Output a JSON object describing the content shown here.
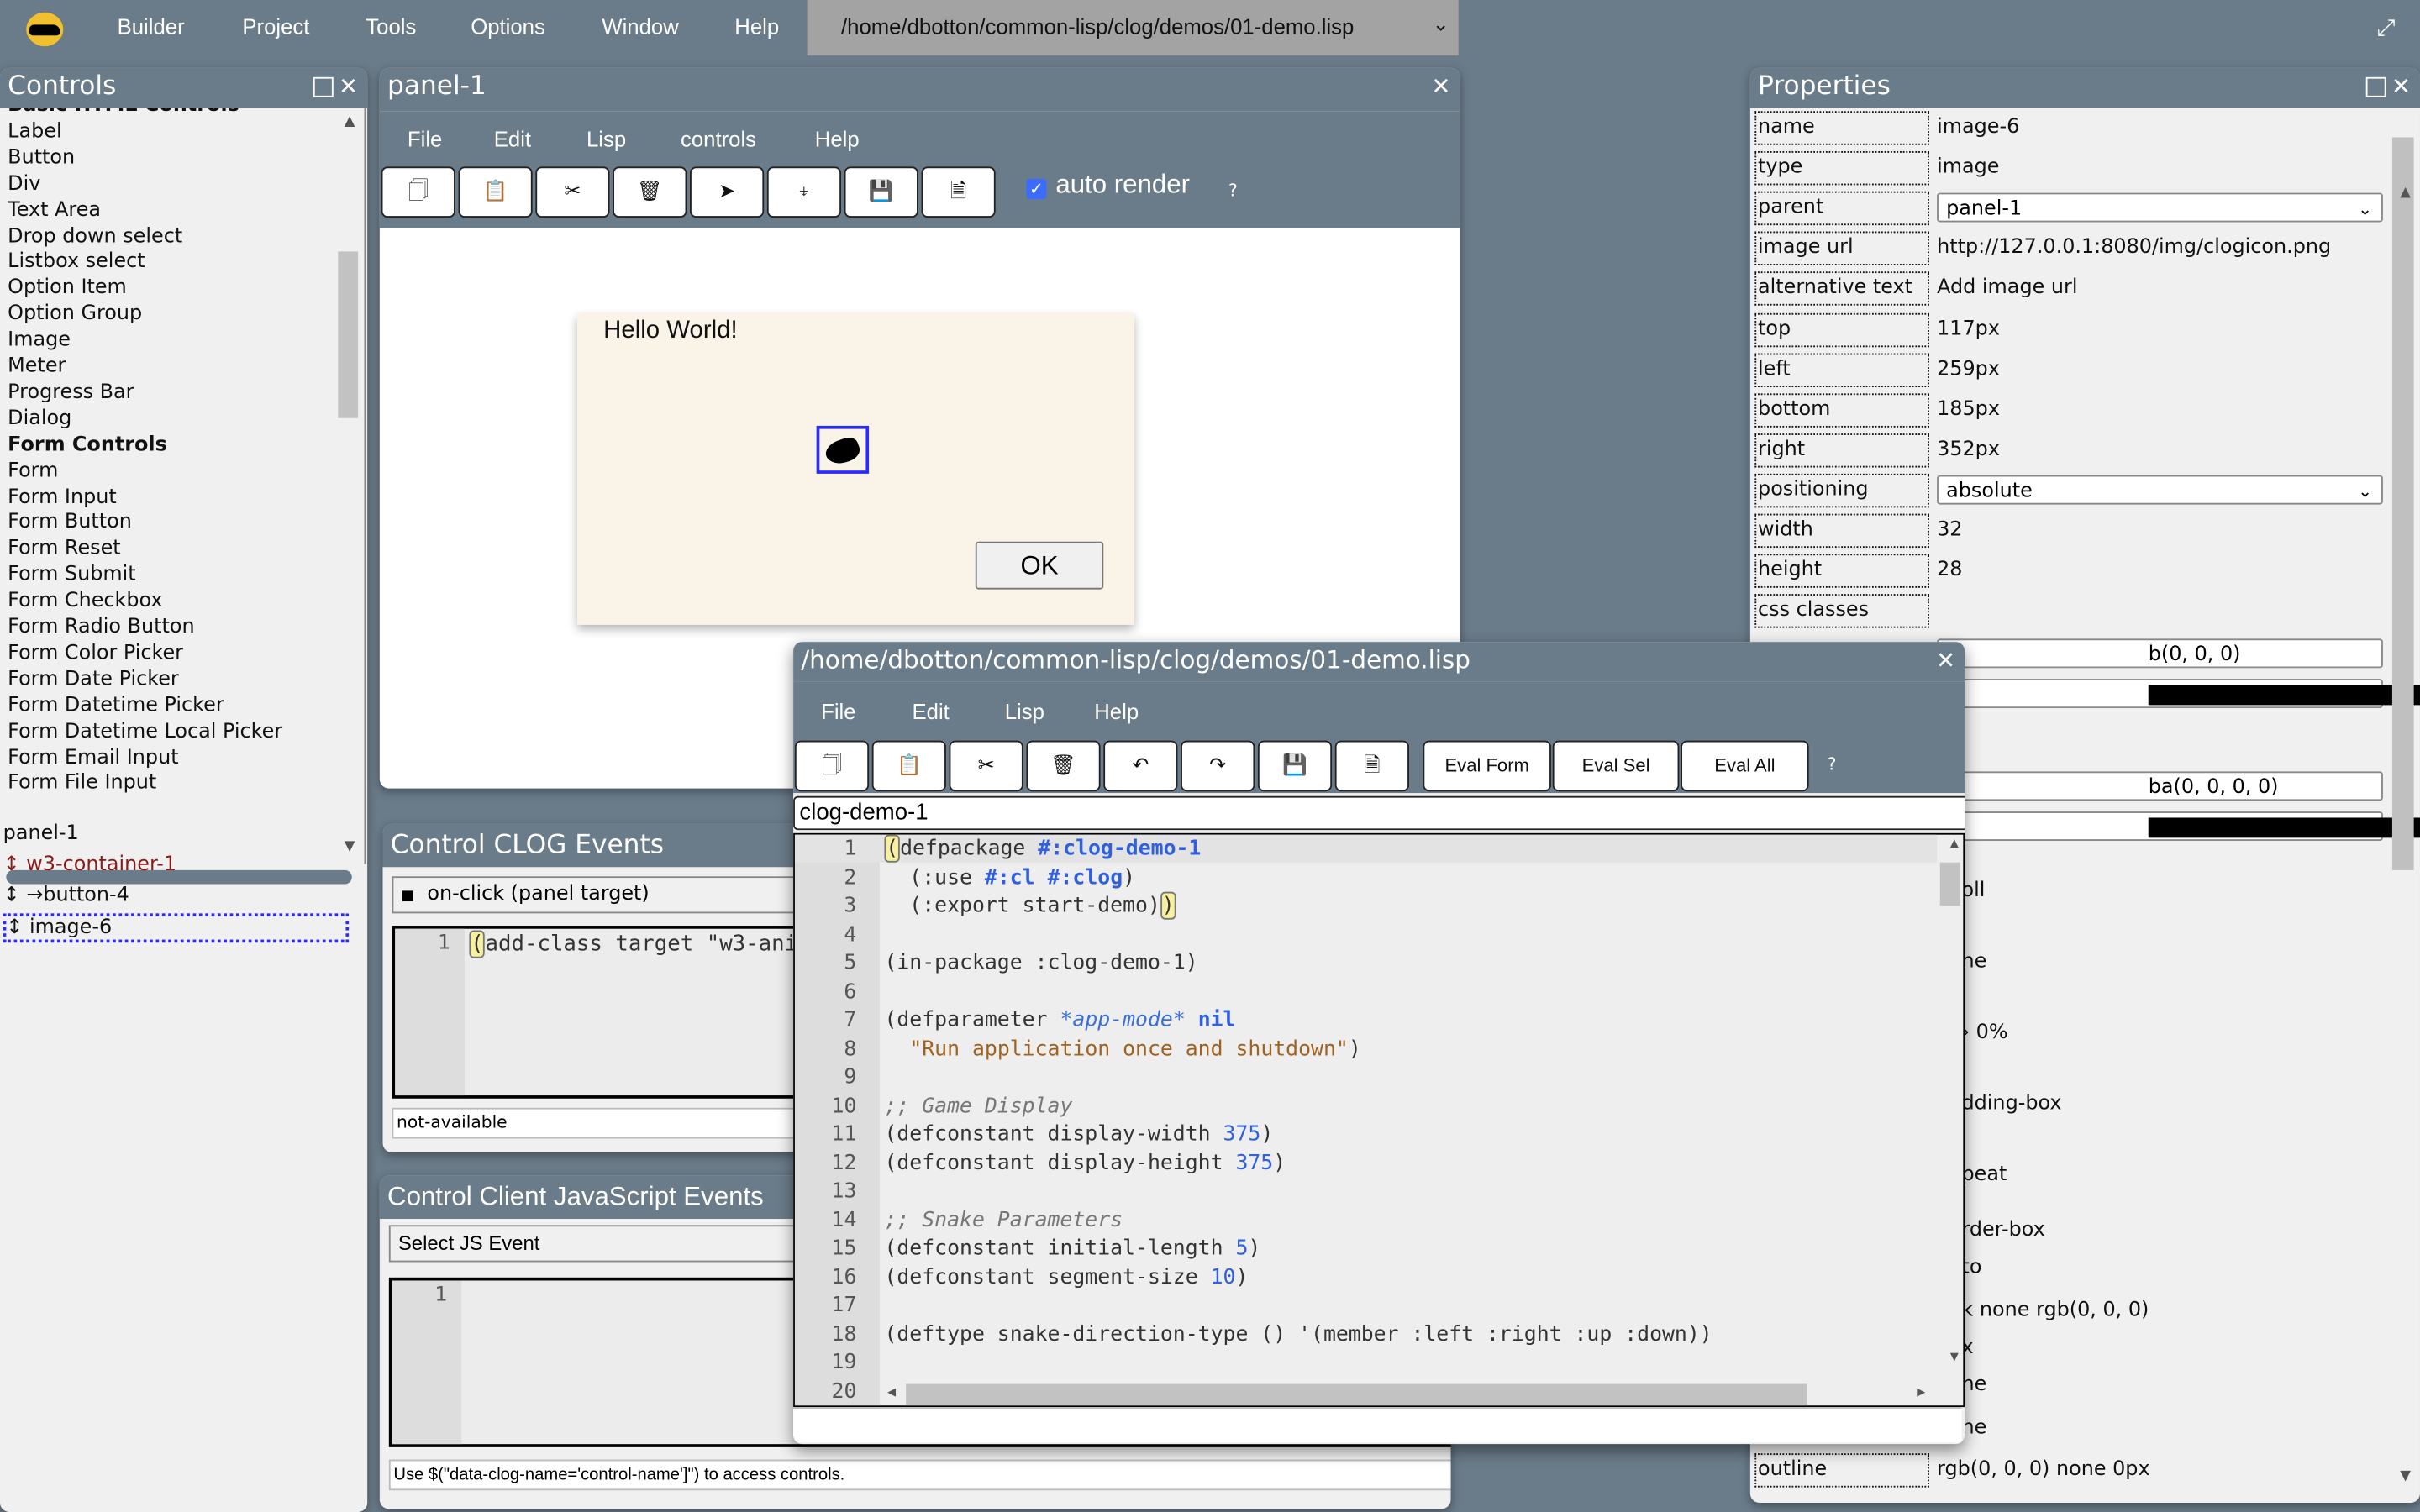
{
  "topbar": {
    "menu": [
      "Builder",
      "Project",
      "Tools",
      "Options",
      "Window",
      "Help"
    ],
    "file_select": "/home/dbotton/common-lisp/clog/demos/01-demo.lisp"
  },
  "controls": {
    "title": "Controls",
    "items": [
      {
        "label": "Basic HTML Controls",
        "bold": true
      },
      {
        "label": "Label"
      },
      {
        "label": "Button"
      },
      {
        "label": "Div"
      },
      {
        "label": "Text Area"
      },
      {
        "label": "Drop down select"
      },
      {
        "label": "Listbox select"
      },
      {
        "label": "Option Item"
      },
      {
        "label": "Option Group"
      },
      {
        "label": "Image"
      },
      {
        "label": "Meter"
      },
      {
        "label": "Progress Bar"
      },
      {
        "label": "Dialog"
      },
      {
        "label": "Form Controls",
        "bold": true
      },
      {
        "label": "Form"
      },
      {
        "label": "Form Input"
      },
      {
        "label": "Form Button"
      },
      {
        "label": "Form Reset"
      },
      {
        "label": "Form Submit"
      },
      {
        "label": "Form Checkbox"
      },
      {
        "label": "Form Radio Button"
      },
      {
        "label": "Form Color Picker"
      },
      {
        "label": "Form Date Picker"
      },
      {
        "label": "Form Datetime Picker"
      },
      {
        "label": "Form Datetime Local Picker"
      },
      {
        "label": "Form Email Input"
      },
      {
        "label": "Form File Input"
      }
    ],
    "tree": [
      {
        "label": "panel-1",
        "prefix": ""
      },
      {
        "label": "w3-container-1",
        "prefix": "↕ ",
        "color": "#8b1a1a"
      },
      {
        "label": "→button-4",
        "prefix": "↕ "
      },
      {
        "label": "image-6",
        "prefix": "↕ ",
        "selected": true
      }
    ]
  },
  "panel": {
    "title": "panel-1",
    "menu": [
      "File",
      "Edit",
      "Lisp",
      "controls",
      "Help"
    ],
    "toolbar_icons": [
      "copy-icon",
      "paste-icon",
      "cut-icon",
      "delete-icon",
      "render-icon",
      "paste-to-icon",
      "save-icon",
      "export-icon"
    ],
    "toolbar_glyphs": [
      "🗍",
      "📋",
      "✂",
      "🗑",
      "➤",
      "⍖",
      "💾",
      "🗎"
    ],
    "auto_render_label": "auto render",
    "auto_render_checked": true,
    "help": "?",
    "dialog": {
      "text": "Hello World!",
      "ok": "OK"
    }
  },
  "clog_events": {
    "title": "Control CLOG Events",
    "event": "on-click (panel target)",
    "line_number": "1",
    "code": "add-class target \"w3-ani",
    "status": "not-available"
  },
  "js_events": {
    "title": "Control Client JavaScript Events",
    "select": "Select JS Event",
    "line_number": "1",
    "status": "Use $(\"data-clog-name='control-name']\") to access controls."
  },
  "properties": {
    "title": "Properties",
    "rows": [
      {
        "label": "name",
        "value": "image-6"
      },
      {
        "label": "type",
        "value": "image"
      },
      {
        "label": "parent",
        "value": "panel-1",
        "select": true
      },
      {
        "label": "image url",
        "value": "http://127.0.0.1:8080/img/clogicon.png"
      },
      {
        "label": "alternative text",
        "value": "Add image url"
      },
      {
        "label": "top",
        "value": "117px"
      },
      {
        "label": "left",
        "value": "259px"
      },
      {
        "label": "bottom",
        "value": "185px"
      },
      {
        "label": "right",
        "value": "352px"
      },
      {
        "label": "positioning",
        "value": "absolute",
        "select": true
      },
      {
        "label": "width",
        "value": "32"
      },
      {
        "label": "height",
        "value": "28"
      },
      {
        "label": "css classes",
        "value": ""
      }
    ],
    "partial_values": [
      "b(0, 0, 0)",
      "ba(0, 0, 0, 0)",
      "oll",
      "ne",
      "› 0%",
      "dding-box",
      "peat",
      "rder-box",
      "to",
      "k none rgb(0, 0, 0)",
      "x",
      "ne",
      "ne"
    ],
    "color_select_1": "#000000",
    "color_select_2": "#000000",
    "outline_label": "outline",
    "outline_value": "rgb(0, 0, 0) none 0px"
  },
  "editor": {
    "title": "/home/dbotton/common-lisp/clog/demos/01-demo.lisp",
    "menu": [
      "File",
      "Edit",
      "Lisp",
      "Help"
    ],
    "toolbar_icons": [
      "copy-icon",
      "paste-icon",
      "cut-icon",
      "delete-icon",
      "undo-icon",
      "redo-icon",
      "save-icon",
      "export-icon"
    ],
    "toolbar_glyphs": [
      "🗍",
      "📋",
      "✂",
      "🗑",
      "↶",
      "↷",
      "💾",
      "🗎"
    ],
    "eval_buttons": [
      "Eval Form",
      "Eval Sel",
      "Eval All"
    ],
    "help": "?",
    "package": "clog-demo-1",
    "lines": [
      "1",
      "2",
      "3",
      "4",
      "5",
      "6",
      "7",
      "8",
      "9",
      "10",
      "11",
      "12",
      "13",
      "14",
      "15",
      "16",
      "17",
      "18",
      "19",
      "20"
    ]
  }
}
